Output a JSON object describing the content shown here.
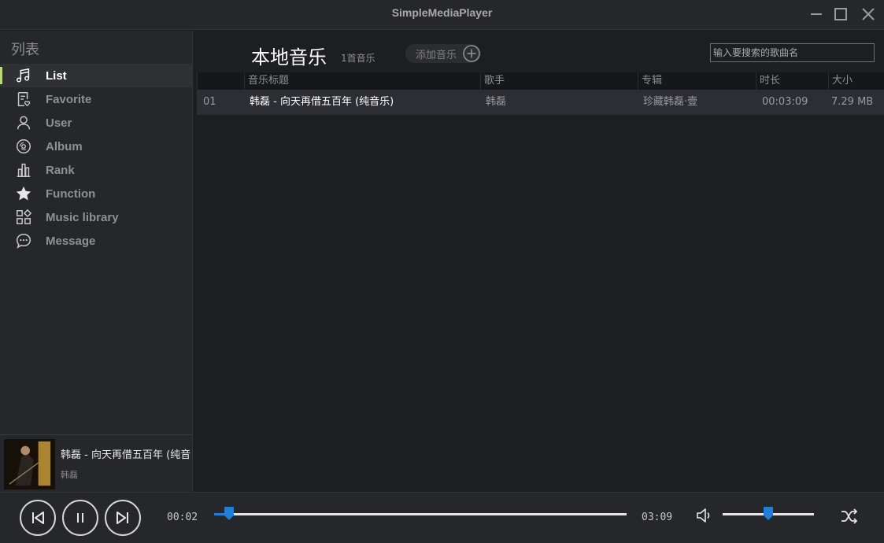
{
  "window": {
    "title": "SimpleMediaPlayer"
  },
  "sidebar": {
    "section_label": "列表",
    "items": [
      {
        "label": "List",
        "icon": "music-note-icon",
        "active": true
      },
      {
        "label": "Favorite",
        "icon": "favorite-list-icon",
        "active": false
      },
      {
        "label": "User",
        "icon": "user-icon",
        "active": false
      },
      {
        "label": "Album",
        "icon": "album-disc-icon",
        "active": false
      },
      {
        "label": "Rank",
        "icon": "rank-chart-icon",
        "active": false
      },
      {
        "label": "Function",
        "icon": "star-icon",
        "active": false
      },
      {
        "label": "Music library",
        "icon": "library-grid-icon",
        "active": false
      },
      {
        "label": "Message",
        "icon": "message-bubble-icon",
        "active": false
      }
    ]
  },
  "now_playing": {
    "title": "韩磊 - 向天再借五百年 (纯音乐)",
    "artist": "韩磊"
  },
  "main": {
    "title": "本地音乐",
    "count": "1首音乐",
    "add_button": "添加音乐",
    "search_placeholder": "输入要搜索的歌曲名",
    "columns": [
      "",
      "音乐标题",
      "歌手",
      "专辑",
      "时长",
      "大小"
    ],
    "rows": [
      {
        "no": "01",
        "title": "韩磊 - 向天再借五百年 (纯音乐)",
        "artist": "韩磊",
        "album": "珍藏韩磊·壹",
        "duration": "00:03:09",
        "size": "7.29 MB"
      }
    ]
  },
  "player": {
    "current_time": "00:02",
    "total_time": "03:09",
    "progress_fraction": 0.018,
    "volume_fraction": 0.5,
    "accent_color": "#1e7fd6",
    "active_color": "#b6d77a"
  }
}
